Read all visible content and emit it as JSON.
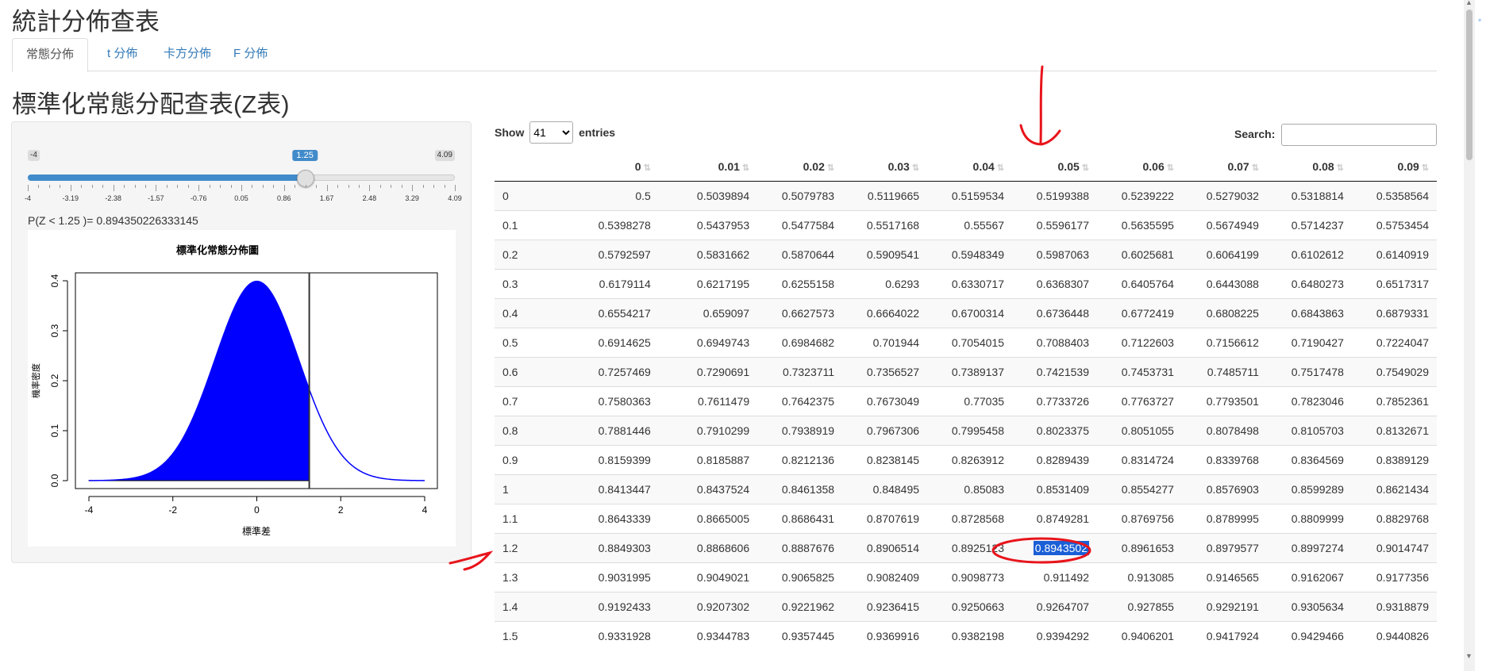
{
  "app": {
    "title": "統計分佈查表"
  },
  "tabs": [
    {
      "label": "常態分佈",
      "active": true
    },
    {
      "label": "t 分佈",
      "active": false
    },
    {
      "label": "卡方分佈",
      "active": false
    },
    {
      "label": "F 分佈",
      "active": false
    }
  ],
  "section_title": "標準化常態分配查表(Z表)",
  "slider": {
    "min_label": "-4",
    "max_label": "4.09",
    "value_label": "1.25",
    "min": -4,
    "max": 4.09,
    "value": 1.25,
    "ticks": [
      "-4",
      "-3.19",
      "-2.38",
      "-1.57",
      "-0.76",
      "0.05",
      "0.86",
      "1.67",
      "2.48",
      "3.29",
      "4.09"
    ]
  },
  "probability_text": "P(Z < 1.25 )= 0.894350226333145",
  "chart_data": {
    "type": "area",
    "title": "標準化常態分佈圖",
    "xlabel": "標準差",
    "ylabel": "機率密度",
    "xlim": [
      -4,
      4
    ],
    "ylim": [
      0,
      0.4
    ],
    "x_ticks": [
      "-4",
      "-2",
      "0",
      "2",
      "4"
    ],
    "y_ticks": [
      "0.0",
      "0.1",
      "0.2",
      "0.3",
      "0.4"
    ],
    "curve": "standard normal density",
    "shaded_upto": 1.25,
    "fill_color": "#0000ff",
    "line_color": "#0000ff"
  },
  "table_controls": {
    "show_label": "Show",
    "page_length": "41",
    "entries_label": "entries",
    "search_label": "Search:",
    "search_value": ""
  },
  "table": {
    "columns": [
      "",
      "0",
      "0.01",
      "0.02",
      "0.03",
      "0.04",
      "0.05",
      "0.06",
      "0.07",
      "0.08",
      "0.09"
    ],
    "rows": [
      [
        "0",
        "0.5",
        "0.5039894",
        "0.5079783",
        "0.5119665",
        "0.5159534",
        "0.5199388",
        "0.5239222",
        "0.5279032",
        "0.5318814",
        "0.5358564"
      ],
      [
        "0.1",
        "0.5398278",
        "0.5437953",
        "0.5477584",
        "0.5517168",
        "0.55567",
        "0.5596177",
        "0.5635595",
        "0.5674949",
        "0.5714237",
        "0.5753454"
      ],
      [
        "0.2",
        "0.5792597",
        "0.5831662",
        "0.5870644",
        "0.5909541",
        "0.5948349",
        "0.5987063",
        "0.6025681",
        "0.6064199",
        "0.6102612",
        "0.6140919"
      ],
      [
        "0.3",
        "0.6179114",
        "0.6217195",
        "0.6255158",
        "0.6293",
        "0.6330717",
        "0.6368307",
        "0.6405764",
        "0.6443088",
        "0.6480273",
        "0.6517317"
      ],
      [
        "0.4",
        "0.6554217",
        "0.659097",
        "0.6627573",
        "0.6664022",
        "0.6700314",
        "0.6736448",
        "0.6772419",
        "0.6808225",
        "0.6843863",
        "0.6879331"
      ],
      [
        "0.5",
        "0.6914625",
        "0.6949743",
        "0.6984682",
        "0.701944",
        "0.7054015",
        "0.7088403",
        "0.7122603",
        "0.7156612",
        "0.7190427",
        "0.7224047"
      ],
      [
        "0.6",
        "0.7257469",
        "0.7290691",
        "0.7323711",
        "0.7356527",
        "0.7389137",
        "0.7421539",
        "0.7453731",
        "0.7485711",
        "0.7517478",
        "0.7549029"
      ],
      [
        "0.7",
        "0.7580363",
        "0.7611479",
        "0.7642375",
        "0.7673049",
        "0.77035",
        "0.7733726",
        "0.7763727",
        "0.7793501",
        "0.7823046",
        "0.7852361"
      ],
      [
        "0.8",
        "0.7881446",
        "0.7910299",
        "0.7938919",
        "0.7967306",
        "0.7995458",
        "0.8023375",
        "0.8051055",
        "0.8078498",
        "0.8105703",
        "0.8132671"
      ],
      [
        "0.9",
        "0.8159399",
        "0.8185887",
        "0.8212136",
        "0.8238145",
        "0.8263912",
        "0.8289439",
        "0.8314724",
        "0.8339768",
        "0.8364569",
        "0.8389129"
      ],
      [
        "1",
        "0.8413447",
        "0.8437524",
        "0.8461358",
        "0.848495",
        "0.85083",
        "0.8531409",
        "0.8554277",
        "0.8576903",
        "0.8599289",
        "0.8621434"
      ],
      [
        "1.1",
        "0.8643339",
        "0.8665005",
        "0.8686431",
        "0.8707619",
        "0.8728568",
        "0.8749281",
        "0.8769756",
        "0.8789995",
        "0.8809999",
        "0.8829768"
      ],
      [
        "1.2",
        "0.8849303",
        "0.8868606",
        "0.8887676",
        "0.8906514",
        "0.8925123",
        "0.8943502",
        "0.8961653",
        "0.8979577",
        "0.8997274",
        "0.9014747"
      ],
      [
        "1.3",
        "0.9031995",
        "0.9049021",
        "0.9065825",
        "0.9082409",
        "0.9098773",
        "0.911492",
        "0.913085",
        "0.9146565",
        "0.9162067",
        "0.9177356"
      ],
      [
        "1.4",
        "0.9192433",
        "0.9207302",
        "0.9221962",
        "0.9236415",
        "0.9250663",
        "0.9264707",
        "0.927855",
        "0.9292191",
        "0.9305634",
        "0.9318879"
      ],
      [
        "1.5",
        "0.9331928",
        "0.9344783",
        "0.9357445",
        "0.9369916",
        "0.9382198",
        "0.9394292",
        "0.9406201",
        "0.9417924",
        "0.9429466",
        "0.9440826"
      ]
    ],
    "highlight": {
      "row": 12,
      "col": 6
    }
  }
}
